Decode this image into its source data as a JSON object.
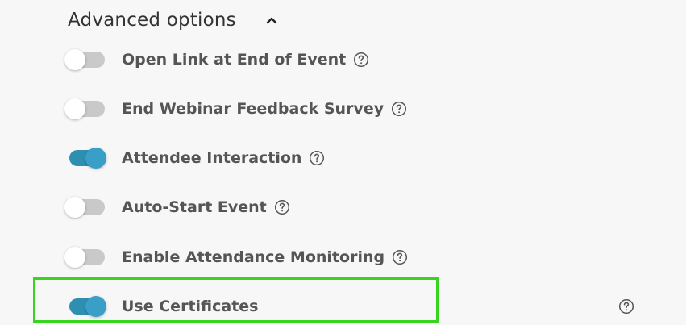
{
  "section": {
    "title": "Advanced options",
    "expanded": true
  },
  "options": [
    {
      "label": "Open Link at End of Event",
      "enabled": false
    },
    {
      "label": "End Webinar Feedback Survey",
      "enabled": false
    },
    {
      "label": "Attendee Interaction",
      "enabled": true
    },
    {
      "label": "Auto-Start Event",
      "enabled": false
    },
    {
      "label": "Enable Attendance Monitoring",
      "enabled": false
    },
    {
      "label": "Use Certificates",
      "enabled": true
    }
  ],
  "colors": {
    "toggle_on": "#2f8fb1",
    "toggle_off": "#c9c9c9",
    "highlight": "#39d420"
  },
  "icons": {
    "help": "question-circle-icon",
    "collapse": "chevron-up-icon"
  }
}
